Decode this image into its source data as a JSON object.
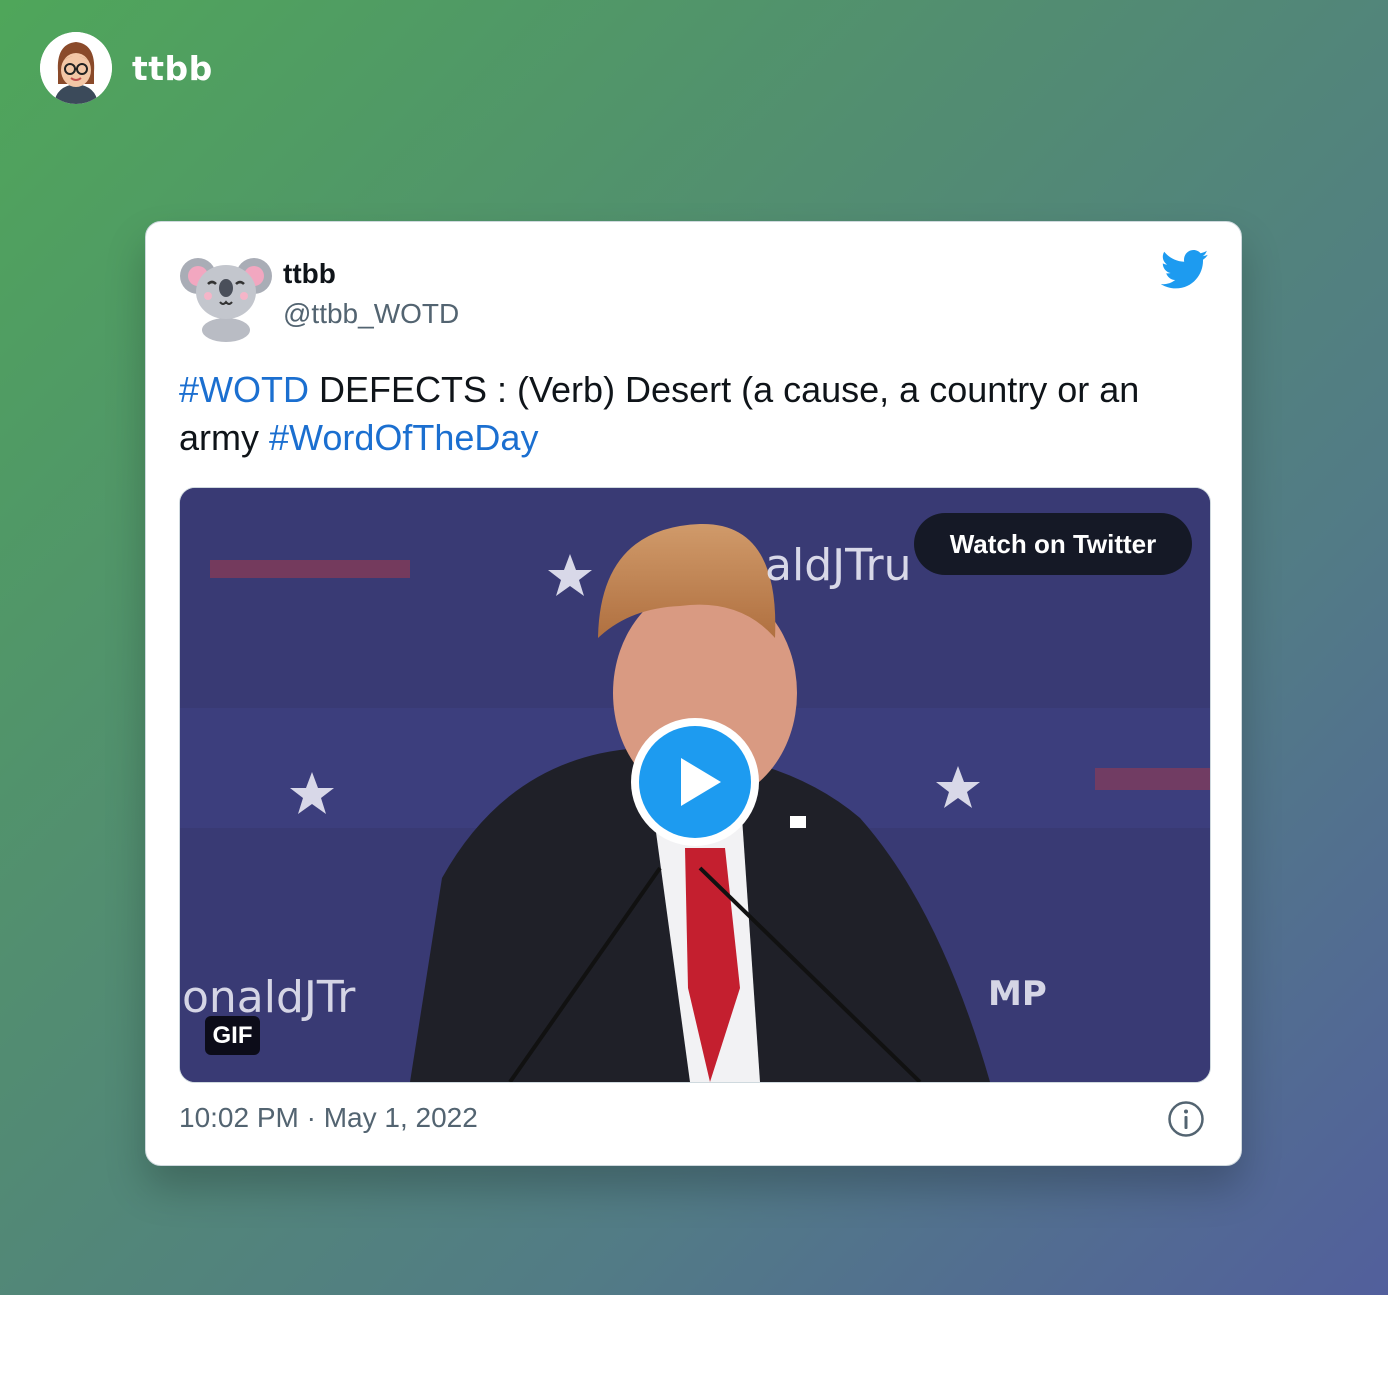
{
  "brand": {
    "name": "ttbb",
    "avatar_icon": "woman-with-glasses-avatar-icon"
  },
  "tweet": {
    "author_name": "ttbb",
    "author_handle": "@ttbb_WOTD",
    "avatar_icon": "koala-avatar-icon",
    "logo_icon": "twitter-bird-icon",
    "text_parts": {
      "tag1": "#WOTD",
      "body": " DEFECTS : (Verb) Desert (a cause, a country or an army ",
      "tag2": "#WordOfTheDay"
    },
    "media": {
      "watch_label": "Watch on Twitter",
      "gif_badge": "GIF",
      "banner_text_top": "aldJTru",
      "banner_text_left": "onaldJTr",
      "banner_text_right": "MP",
      "play_icon": "play-icon"
    },
    "timestamp": "10:02 PM · May 1, 2022",
    "info_icon": "info-icon"
  },
  "colors": {
    "accent": "#1d9bf0",
    "hashtag": "#1b6fd0",
    "text": "#0f1419",
    "muted": "#536471",
    "gradient_start": "#4fa65a",
    "gradient_end": "#525f9c"
  }
}
